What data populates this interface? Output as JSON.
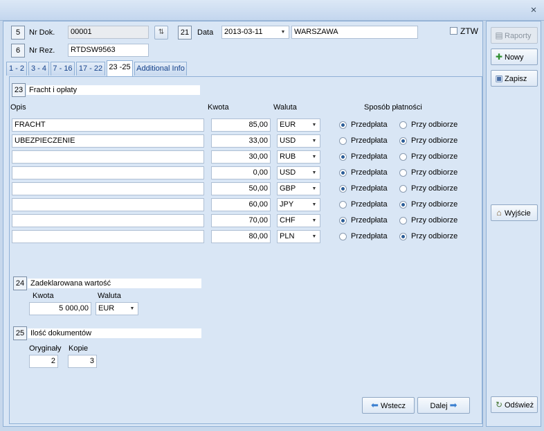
{
  "window": {
    "close_glyph": "×"
  },
  "header": {
    "box5": "5",
    "nr_dok_label": "Nr Dok.",
    "nr_dok_value": "00001",
    "box6": "6",
    "nr_rez_label": "Nr Rez.",
    "nr_rez_value": "RTDSW9563",
    "box21": "21",
    "data_label": "Data",
    "date_value": "2013-03-11",
    "city_value": "WARSZAWA",
    "ztw_label": "ZTW"
  },
  "tabs": [
    "1 - 2",
    "3 - 4",
    "7 - 16",
    "17 - 22",
    "23 -25",
    "Additional Info"
  ],
  "active_tab": 4,
  "section23": {
    "num": "23",
    "title": "Fracht i opłaty",
    "col_opis": "Opis",
    "col_kwota": "Kwota",
    "col_waluta": "Waluta",
    "col_sposob": "Sposób płatności",
    "radio_pre": "Przedpłata",
    "radio_odb": "Przy odbiorze",
    "rows": [
      {
        "opis": "FRACHT",
        "kwota": "85,00",
        "waluta": "EUR",
        "payment": "pre"
      },
      {
        "opis": "UBEZPIECZENIE",
        "kwota": "33,00",
        "waluta": "USD",
        "payment": "odb"
      },
      {
        "opis": "",
        "kwota": "30,00",
        "waluta": "RUB",
        "payment": "pre"
      },
      {
        "opis": "",
        "kwota": "0,00",
        "waluta": "USD",
        "payment": "pre"
      },
      {
        "opis": "",
        "kwota": "50,00",
        "waluta": "GBP",
        "payment": "pre"
      },
      {
        "opis": "",
        "kwota": "60,00",
        "waluta": "JPY",
        "payment": "odb"
      },
      {
        "opis": "",
        "kwota": "70,00",
        "waluta": "CHF",
        "payment": "pre"
      },
      {
        "opis": "",
        "kwota": "80,00",
        "waluta": "PLN",
        "payment": "odb"
      }
    ]
  },
  "section24": {
    "num": "24",
    "title": "Zadeklarowana wartość",
    "kwota_label": "Kwota",
    "waluta_label": "Waluta",
    "kwota_value": "5 000,00",
    "waluta_value": "EUR"
  },
  "section25": {
    "num": "25",
    "title": "Ilość dokumentów",
    "oryginaly_label": "Oryginały",
    "kopie_label": "Kopie",
    "oryginaly_value": "2",
    "kopie_value": "3"
  },
  "nav": {
    "back_label": "Wstecz",
    "next_label": "Dalej"
  },
  "sidebar": {
    "raporty": "Raporty",
    "nowy": "Nowy",
    "zapisz": "Zapisz",
    "wyjscie": "Wyjście",
    "odswiez": "Odśwież"
  }
}
